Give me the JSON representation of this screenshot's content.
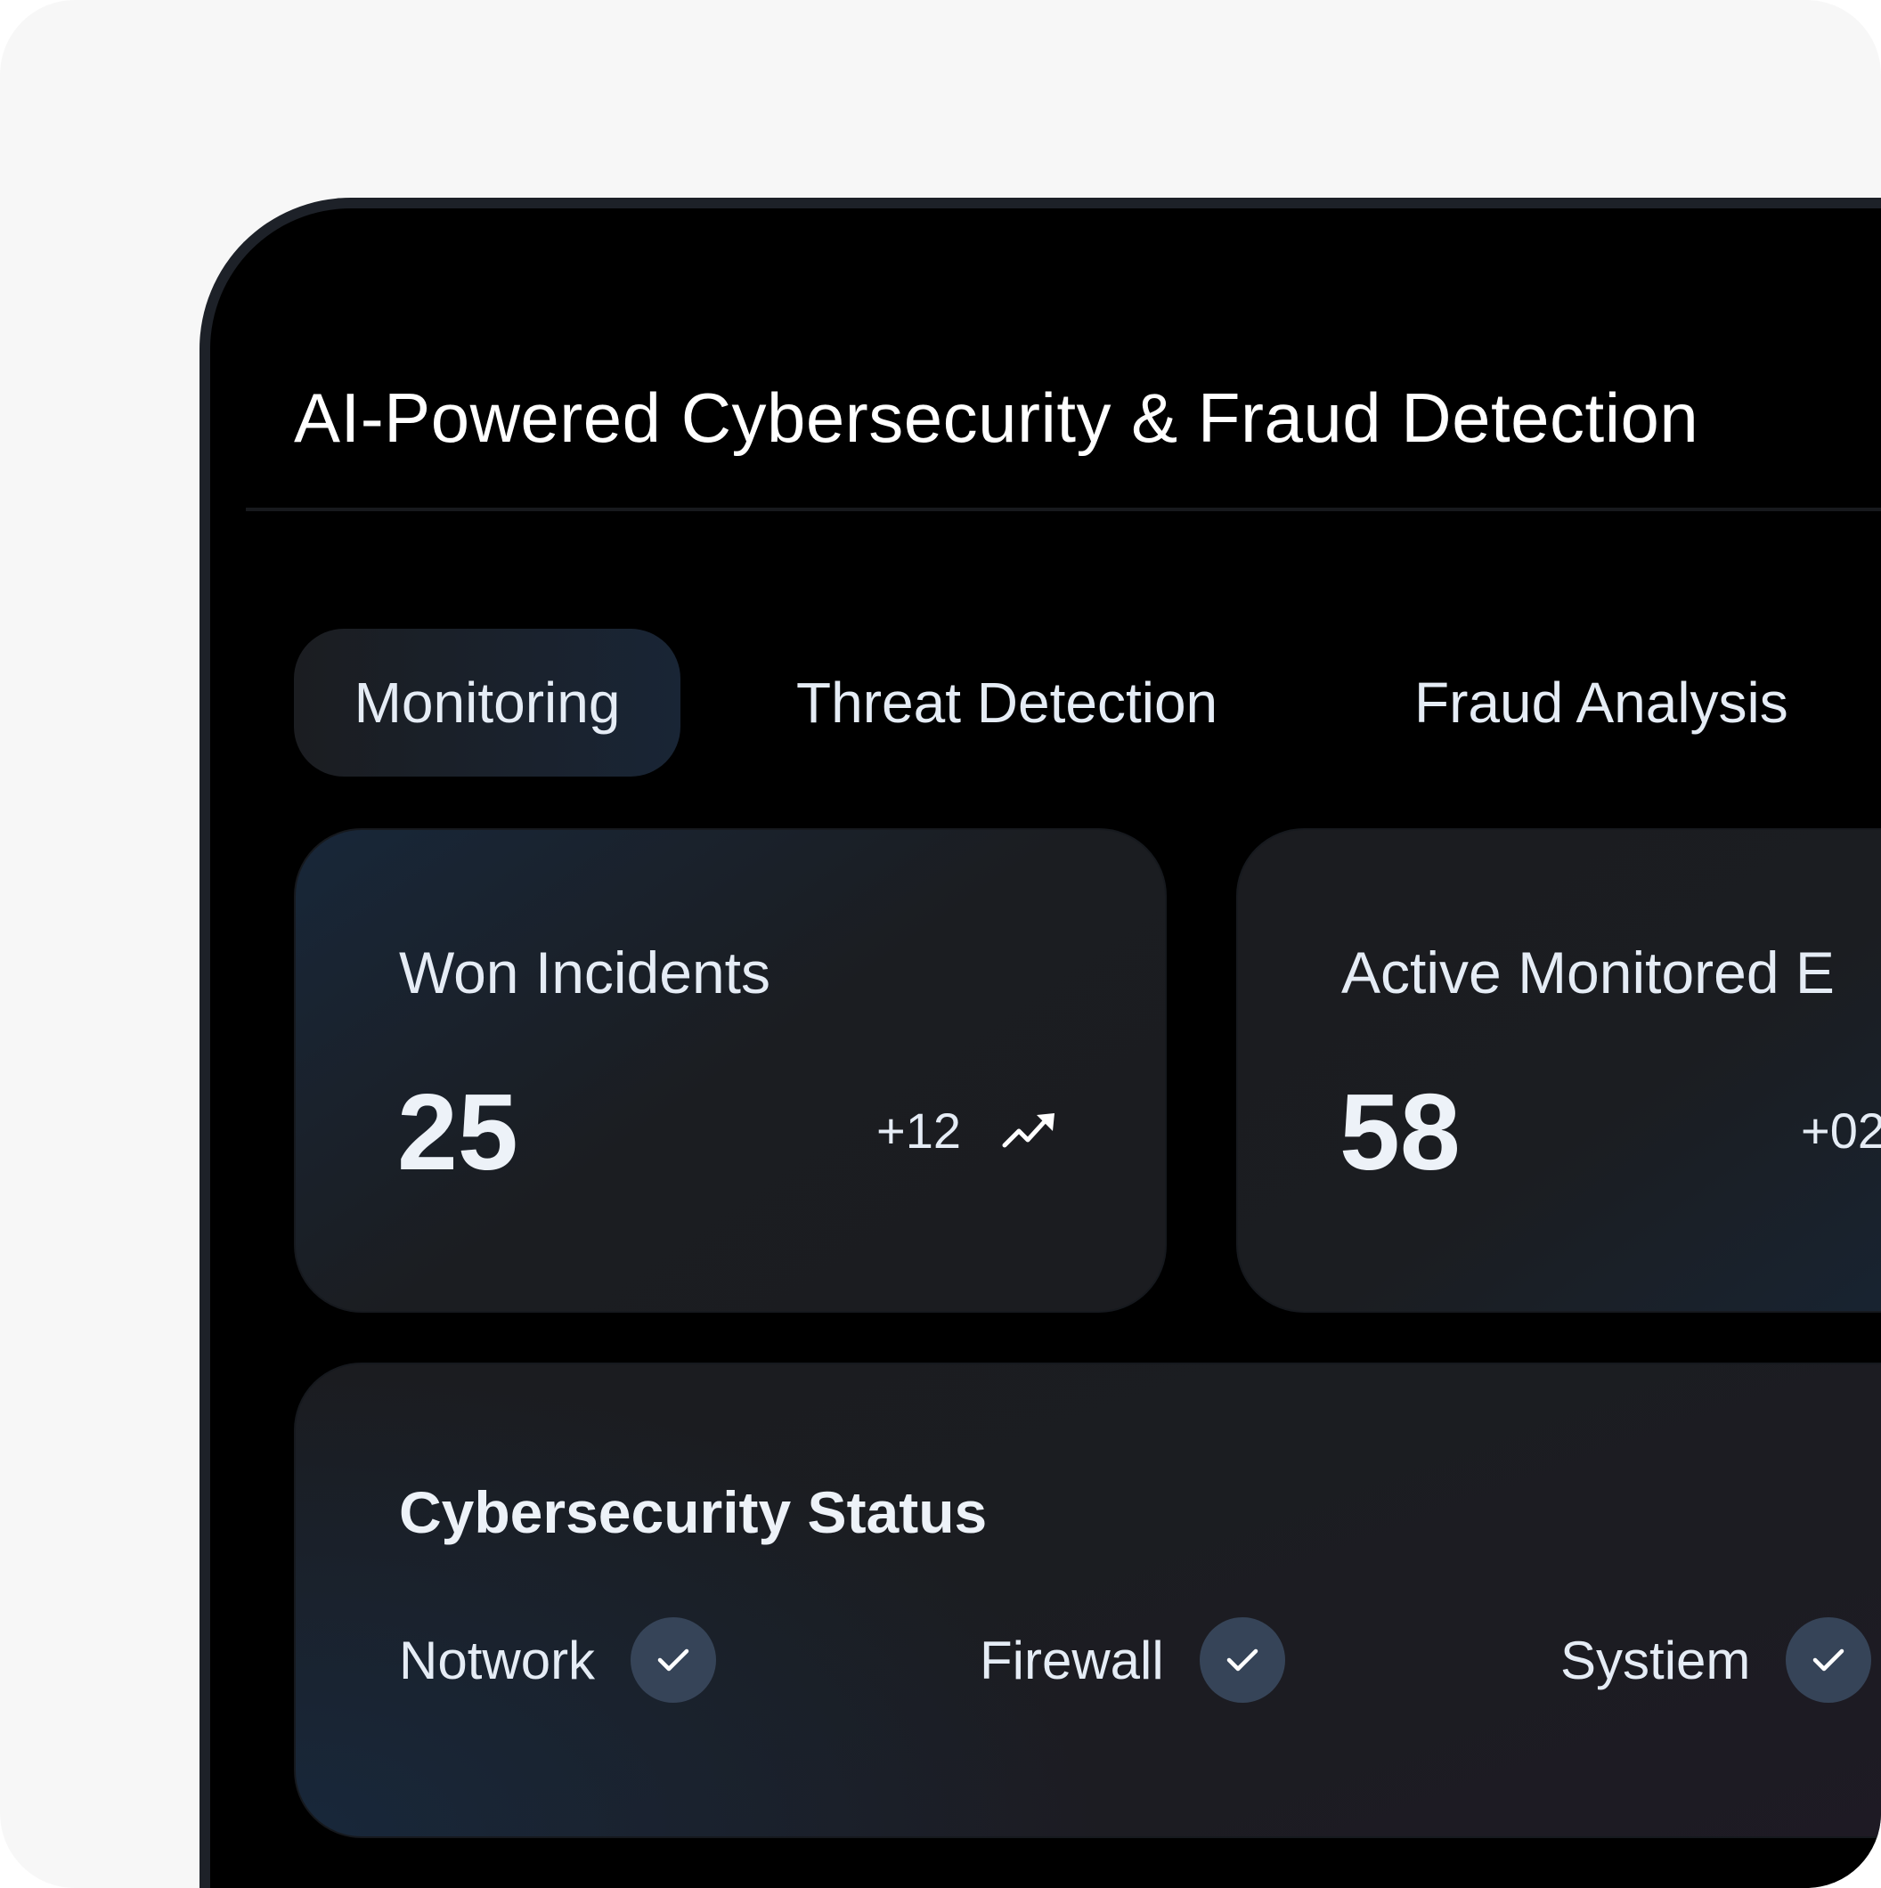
{
  "app": {
    "title": "AI-Powered Cybersecurity & Fraud Detection"
  },
  "tabs": [
    {
      "label": "Monitoring",
      "active": true
    },
    {
      "label": "Threat Detection",
      "active": false
    },
    {
      "label": "Fraud Analysis",
      "active": false
    }
  ],
  "stats": [
    {
      "label": "Won Incidents",
      "value": "25",
      "change": "+12",
      "trend_icon": "trending-up-icon"
    },
    {
      "label": "Active Monitored E",
      "value": "58",
      "change": "+02"
    }
  ],
  "status_panel": {
    "title": "Cybersecurity Status",
    "items": [
      {
        "label": "Notwork",
        "icon": "check-icon"
      },
      {
        "label": "Firewall",
        "icon": "check-icon"
      },
      {
        "label": "Systiem",
        "icon": "check-icon"
      }
    ]
  },
  "colors": {
    "page_background": "#f7f7f7",
    "device_background": "#000000",
    "card_background": "#1b1d21",
    "accent_navy": "#182739",
    "check_badge": "#364458",
    "text_primary": "#e5ecf5"
  }
}
